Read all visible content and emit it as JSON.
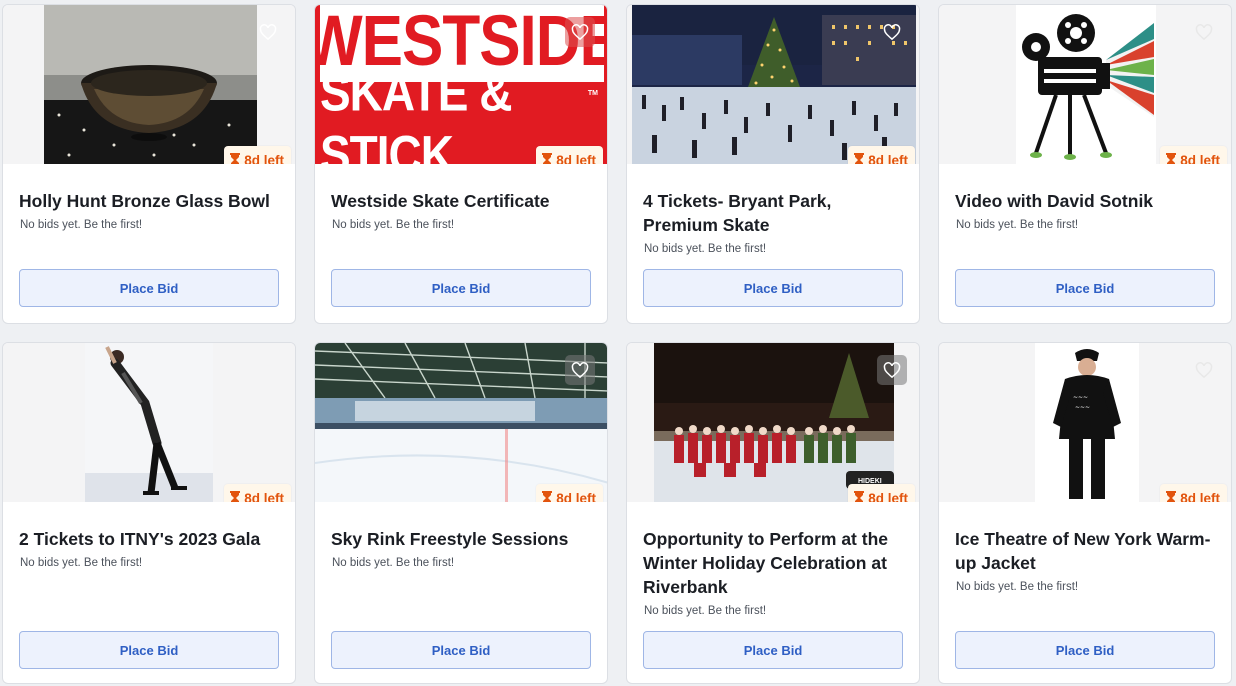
{
  "ui": {
    "accent": "#2f5fc4",
    "timer_color": "#e2540d",
    "icon_favorite": "heart-outline-icon",
    "icon_timer": "hourglass-icon"
  },
  "items": [
    {
      "title": "Holly Hunt Bronze Glass Bowl",
      "bids": "No bids yet. Be the first!",
      "time_left": "8d left",
      "button": "Place Bid"
    },
    {
      "title": "Westside Skate Certificate",
      "bids": "No bids yet. Be the first!",
      "time_left": "8d left",
      "button": "Place Bid",
      "logo_line1": "WESTSIDE",
      "logo_line2": "SKATE & STICK",
      "logo_tm": "TM"
    },
    {
      "title": "4 Tickets- Bryant Park, Premium Skate",
      "bids": "No bids yet. Be the first!",
      "time_left": "8d left",
      "button": "Place Bid"
    },
    {
      "title": "Video with David Sotnik",
      "bids": "No bids yet. Be the first!",
      "time_left": "8d left",
      "button": "Place Bid"
    },
    {
      "title": "2 Tickets to ITNY's 2023 Gala",
      "bids": "No bids yet. Be the first!",
      "time_left": "8d left",
      "button": "Place Bid"
    },
    {
      "title": "Sky Rink Freestyle Sessions",
      "bids": "No bids yet. Be the first!",
      "time_left": "8d left",
      "button": "Place Bid"
    },
    {
      "title": "Opportunity to Perform at the Winter Holiday Celebration at Riverbank",
      "bids": "No bids yet. Be the first!",
      "time_left": "8d left",
      "button": "Place Bid",
      "photo_tag": "HIDEKI"
    },
    {
      "title": "Ice Theatre of New York Warm-up Jacket",
      "bids": "No bids yet. Be the first!",
      "time_left": "8d left",
      "button": "Place Bid"
    }
  ]
}
